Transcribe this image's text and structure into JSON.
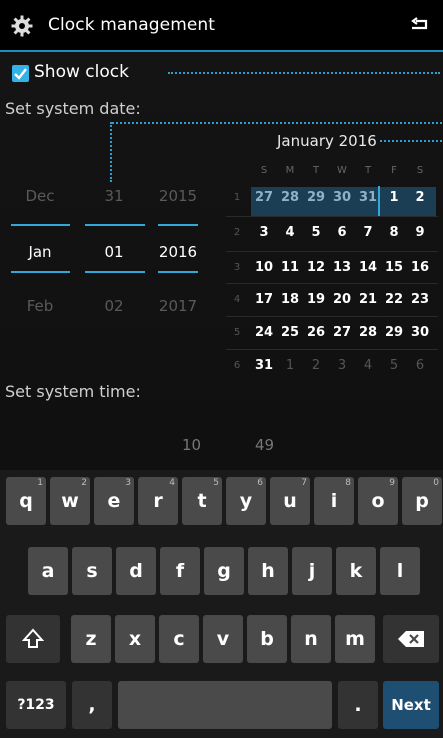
{
  "header": {
    "title": "Clock management"
  },
  "show_clock": {
    "label": "Show clock",
    "checked": true
  },
  "date_section": {
    "label": "Set system date:",
    "month": {
      "prev": "Dec",
      "current": "Jan",
      "next": "Feb"
    },
    "day": {
      "prev": "31",
      "current": "01",
      "next": "02"
    },
    "year": {
      "prev": "2015",
      "current": "2016",
      "next": "2017"
    }
  },
  "calendar": {
    "month_title": "January 2016",
    "weekday_headers": [
      "S",
      "M",
      "T",
      "W",
      "T",
      "F",
      "S"
    ],
    "week_numbers": [
      "1",
      "2",
      "3",
      "4",
      "5",
      "6"
    ],
    "weeks": [
      [
        "27",
        "28",
        "29",
        "30",
        "31",
        "1",
        "2"
      ],
      [
        "3",
        "4",
        "5",
        "6",
        "7",
        "8",
        "9"
      ],
      [
        "10",
        "11",
        "12",
        "13",
        "14",
        "15",
        "16"
      ],
      [
        "17",
        "18",
        "19",
        "20",
        "21",
        "22",
        "23"
      ],
      [
        "24",
        "25",
        "26",
        "27",
        "28",
        "29",
        "30"
      ],
      [
        "31",
        "1",
        "2",
        "3",
        "4",
        "5",
        "6"
      ]
    ]
  },
  "time_section": {
    "label": "Set system time:",
    "hour": "10",
    "minute": "49"
  },
  "keyboard": {
    "row1": [
      {
        "k": "q",
        "h": "1"
      },
      {
        "k": "w",
        "h": "2"
      },
      {
        "k": "e",
        "h": "3"
      },
      {
        "k": "r",
        "h": "4"
      },
      {
        "k": "t",
        "h": "5"
      },
      {
        "k": "y",
        "h": "6"
      },
      {
        "k": "u",
        "h": "7"
      },
      {
        "k": "i",
        "h": "8"
      },
      {
        "k": "o",
        "h": "9"
      },
      {
        "k": "p",
        "h": "0"
      }
    ],
    "row2": [
      "a",
      "s",
      "d",
      "f",
      "g",
      "h",
      "j",
      "k",
      "l"
    ],
    "row3": [
      "z",
      "x",
      "c",
      "v",
      "b",
      "n",
      "m"
    ],
    "symbols_label": "?123",
    "comma": ",",
    "period": ".",
    "next_label": "Next"
  },
  "colors": {
    "accent": "#33a7d8",
    "background": "#000000",
    "next_key": "#1e4f73"
  }
}
